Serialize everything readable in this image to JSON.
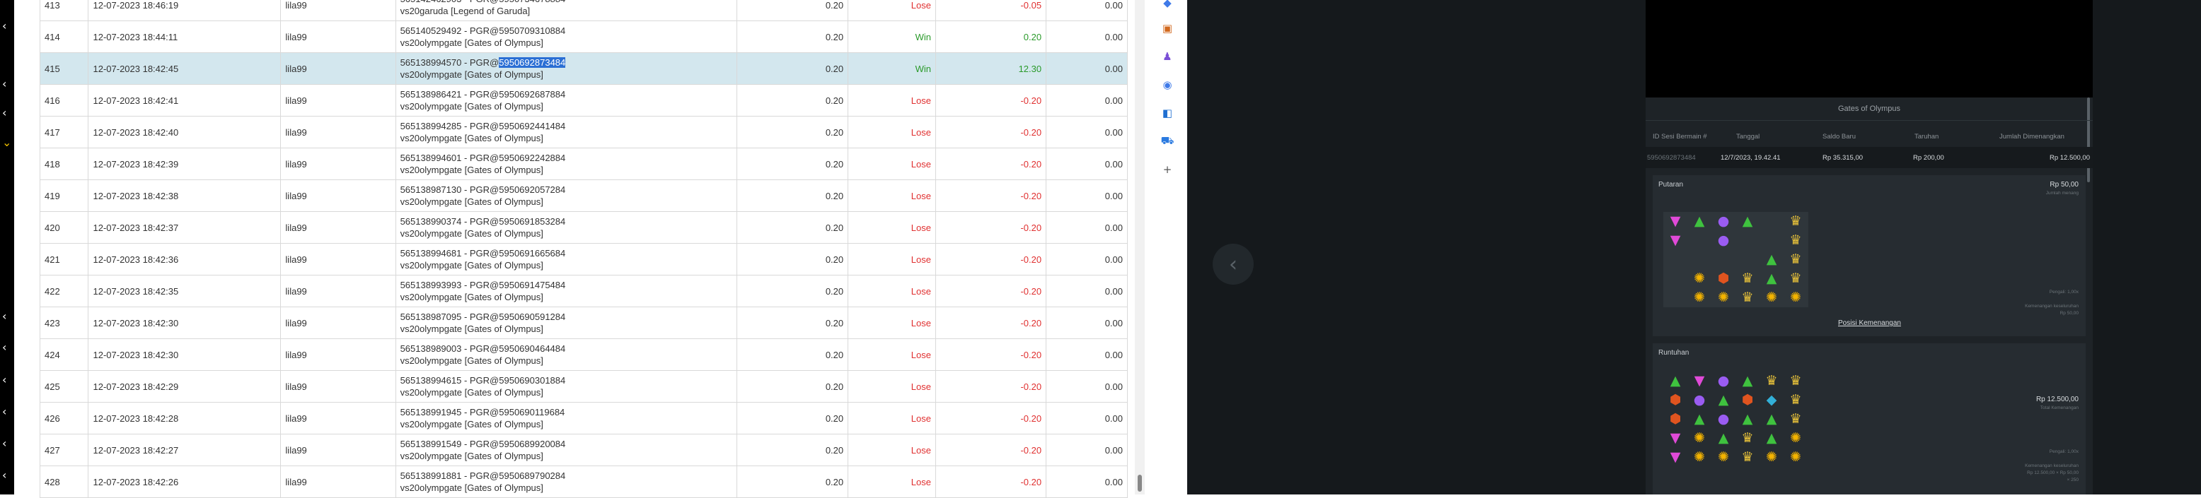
{
  "table": {
    "rows": [
      {
        "no": "413",
        "date": "12-07-2023 18:46:19",
        "user": "lila99",
        "ref1": "565142462903 - PGR@5950734678884",
        "ref2": "vs20garuda [Legend of Garuda]",
        "bet": "0.20",
        "result": "Lose",
        "amount": "-0.05",
        "balance": "0.00"
      },
      {
        "no": "414",
        "date": "12-07-2023 18:44:11",
        "user": "lila99",
        "ref1": "565140529492 - PGR@5950709310884",
        "ref2": "vs20olympgate [Gates of Olympus]",
        "bet": "0.20",
        "result": "Win",
        "amount": "0.20",
        "balance": "0.00"
      },
      {
        "no": "415",
        "date": "12-07-2023 18:42:45",
        "user": "lila99",
        "ref1_prefix": "565138994570 - PGR@",
        "ref1_selected": "5950692873484",
        "ref2": "vs20olympgate [Gates of Olympus]",
        "bet": "0.20",
        "result": "Win",
        "amount": "12.30",
        "balance": "0.00"
      },
      {
        "no": "416",
        "date": "12-07-2023 18:42:41",
        "user": "lila99",
        "ref1": "565138986421 - PGR@5950692687884",
        "ref2": "vs20olympgate [Gates of Olympus]",
        "bet": "0.20",
        "result": "Lose",
        "amount": "-0.20",
        "balance": "0.00"
      },
      {
        "no": "417",
        "date": "12-07-2023 18:42:40",
        "user": "lila99",
        "ref1": "565138994285 - PGR@5950692441484",
        "ref2": "vs20olympgate [Gates of Olympus]",
        "bet": "0.20",
        "result": "Lose",
        "amount": "-0.20",
        "balance": "0.00"
      },
      {
        "no": "418",
        "date": "12-07-2023 18:42:39",
        "user": "lila99",
        "ref1": "565138994601 - PGR@5950692242884",
        "ref2": "vs20olympgate [Gates of Olympus]",
        "bet": "0.20",
        "result": "Lose",
        "amount": "-0.20",
        "balance": "0.00"
      },
      {
        "no": "419",
        "date": "12-07-2023 18:42:38",
        "user": "lila99",
        "ref1": "565138987130 - PGR@5950692057284",
        "ref2": "vs20olympgate [Gates of Olympus]",
        "bet": "0.20",
        "result": "Lose",
        "amount": "-0.20",
        "balance": "0.00"
      },
      {
        "no": "420",
        "date": "12-07-2023 18:42:37",
        "user": "lila99",
        "ref1": "565138990374 - PGR@5950691853284",
        "ref2": "vs20olympgate [Gates of Olympus]",
        "bet": "0.20",
        "result": "Lose",
        "amount": "-0.20",
        "balance": "0.00"
      },
      {
        "no": "421",
        "date": "12-07-2023 18:42:36",
        "user": "lila99",
        "ref1": "565138994681 - PGR@5950691665684",
        "ref2": "vs20olympgate [Gates of Olympus]",
        "bet": "0.20",
        "result": "Lose",
        "amount": "-0.20",
        "balance": "0.00"
      },
      {
        "no": "422",
        "date": "12-07-2023 18:42:35",
        "user": "lila99",
        "ref1": "565138993993 - PGR@5950691475484",
        "ref2": "vs20olympgate [Gates of Olympus]",
        "bet": "0.20",
        "result": "Lose",
        "amount": "-0.20",
        "balance": "0.00"
      },
      {
        "no": "423",
        "date": "12-07-2023 18:42:30",
        "user": "lila99",
        "ref1": "565138987095 - PGR@5950690591284",
        "ref2": "vs20olympgate [Gates of Olympus]",
        "bet": "0.20",
        "result": "Lose",
        "amount": "-0.20",
        "balance": "0.00"
      },
      {
        "no": "424",
        "date": "12-07-2023 18:42:30",
        "user": "lila99",
        "ref1": "565138989003 - PGR@5950690464484",
        "ref2": "vs20olympgate [Gates of Olympus]",
        "bet": "0.20",
        "result": "Lose",
        "amount": "-0.20",
        "balance": "0.00"
      },
      {
        "no": "425",
        "date": "12-07-2023 18:42:29",
        "user": "lila99",
        "ref1": "565138994615 - PGR@5950690301884",
        "ref2": "vs20olympgate [Gates of Olympus]",
        "bet": "0.20",
        "result": "Lose",
        "amount": "-0.20",
        "balance": "0.00"
      },
      {
        "no": "426",
        "date": "12-07-2023 18:42:28",
        "user": "lila99",
        "ref1": "565138991945 - PGR@5950690119684",
        "ref2": "vs20olympgate [Gates of Olympus]",
        "bet": "0.20",
        "result": "Lose",
        "amount": "-0.20",
        "balance": "0.00"
      },
      {
        "no": "427",
        "date": "12-07-2023 18:42:27",
        "user": "lila99",
        "ref1": "565138991549 - PGR@5950689920084",
        "ref2": "vs20olympgate [Gates of Olympus]",
        "bet": "0.20",
        "result": "Lose",
        "amount": "-0.20",
        "balance": "0.00"
      },
      {
        "no": "428",
        "date": "12-07-2023 18:42:26",
        "user": "lila99",
        "ref1": "565138991881 - PGR@5950689790284",
        "ref2": "vs20olympgate [Gates of Olympus]",
        "bet": "0.20",
        "result": "Lose",
        "amount": "-0.20",
        "balance": "0.00"
      }
    ]
  },
  "colors": {
    "win": "#2a9a2a",
    "lose": "#e03030",
    "selected_row": "#d3e7ee",
    "selection": "#2b6fd4"
  },
  "ext_icons": [
    "diamond-icon",
    "toolbox-icon",
    "people-icon",
    "chrome-icon",
    "outlook-icon",
    "cart-icon",
    "plus-icon"
  ],
  "modal": {
    "title": "Gates of Olympus",
    "headers": {
      "session": "ID Sesi Bermain #",
      "date": "Tanggal",
      "balance": "Saldo Baru",
      "bet": "Taruhan",
      "win": "Jumlah Dimenangkan"
    },
    "values": {
      "session": "5950692873484",
      "date": "12/7/2023, 19.42.41",
      "balance": "Rp 35.315,00",
      "bet": "Rp 200,00",
      "win": "Rp 12.500,00"
    },
    "spin": {
      "title": "Putaran",
      "amount": "Rp 50,00",
      "sub": "Jumlah menang",
      "multiplier": "Pengali: 1,00x",
      "total": "Kemenangan keseluruhan",
      "total_value": "Rp 50,00",
      "link": "Posisi Kemenangan"
    },
    "tumble": {
      "title": "Runtuhan",
      "amount": "Rp 12.500,00",
      "sub": "Total Kemenangan",
      "multiplier": "Pengali: 1,00x",
      "total": "Kemenangan keseluruhan",
      "total_value": "Rp 12.500,00 × Rp 50,00",
      "extra": "× 250"
    },
    "spin_grid": [
      [
        "tri-pink",
        "tri-green",
        "orb-blue",
        "tri-green",
        "",
        "crown"
      ],
      [
        "tri-pink",
        "",
        "orb-blue",
        "",
        "",
        "crown"
      ],
      [
        "",
        "",
        "",
        "",
        "tri-green",
        "crown"
      ],
      [
        "",
        "ring-gold",
        "gem-red",
        "crown",
        "tri-green",
        "crown"
      ],
      [
        "",
        "ring-gold",
        "ring-gold",
        "crown",
        "ring-gold",
        "ring-gold"
      ]
    ],
    "tumble_grid": [
      [
        "tri-green",
        "tri-pink",
        "orb-blue",
        "tri-green",
        "crown",
        "crown"
      ],
      [
        "gem-red",
        "orb-blue",
        "tri-green",
        "gem-red",
        "gem-teal",
        "crown"
      ],
      [
        "gem-red",
        "tri-green",
        "orb-blue",
        "tri-green",
        "tri-green",
        "crown"
      ],
      [
        "tri-pink",
        "ring-gold",
        "tri-green",
        "crown",
        "tri-green",
        "ring-gold"
      ],
      [
        "tri-pink",
        "ring-gold",
        "ring-gold",
        "crown",
        "ring-gold",
        "ring-gold"
      ]
    ]
  }
}
